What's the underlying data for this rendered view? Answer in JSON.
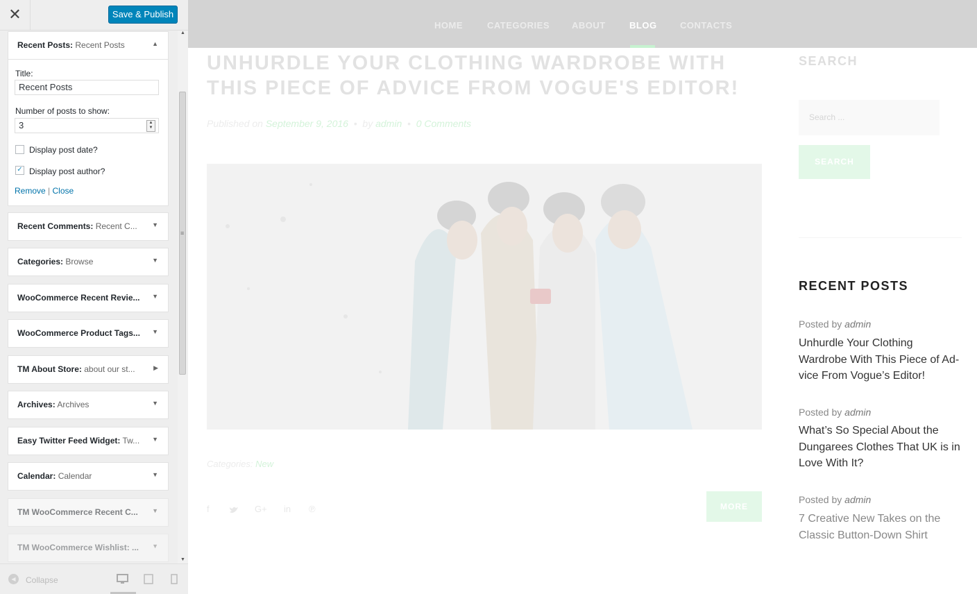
{
  "customizer": {
    "close_glyph": "✕",
    "publish_label": "Save & Publish",
    "open_widget": {
      "name_bold": "Recent Posts:",
      "name_sub": "Recent Posts",
      "arrow": "▲",
      "title_label": "Title:",
      "title_value": "Recent Posts",
      "count_label": "Number of posts to show:",
      "count_value": "3",
      "show_date_label": "Display post date?",
      "show_date_checked": false,
      "show_author_label": "Display post author?",
      "show_author_checked": true,
      "remove_label": "Remove",
      "separator": "|",
      "close_label": "Close"
    },
    "widgets": [
      {
        "bold": "Recent Comments:",
        "sub": "Recent C...",
        "arrow": "▼"
      },
      {
        "bold": "Categories:",
        "sub": "Browse",
        "arrow": "▼"
      },
      {
        "bold": "WooCommerce Recent Revie...",
        "sub": "",
        "arrow": "▼"
      },
      {
        "bold": "WooCommerce Product Tags...",
        "sub": "",
        "arrow": "▼"
      },
      {
        "bold": "TM About Store:",
        "sub": "about our st...",
        "arrow": "▶"
      },
      {
        "bold": "Archives:",
        "sub": "Archives",
        "arrow": "▼"
      },
      {
        "bold": "Easy Twitter Feed Widget:",
        "sub": "Tw...",
        "arrow": "▼"
      },
      {
        "bold": "Calendar:",
        "sub": "Calendar",
        "arrow": "▼"
      },
      {
        "bold": "TM WooCommerce Recent C...",
        "sub": "",
        "arrow": "▼"
      },
      {
        "bold": "TM WooCommerce Wishlist: ...",
        "sub": "",
        "arrow": "▼"
      }
    ],
    "collapse_label": "Collapse",
    "device_icons": [
      "desktop-icon",
      "tablet-icon",
      "mobile-icon"
    ]
  },
  "site": {
    "nav": [
      "HOME",
      "CATEGORIES",
      "ABOUT",
      "BLOG",
      "CONTACTS"
    ],
    "nav_active": "BLOG",
    "post": {
      "title": "UNHURDLE YOUR CLOTHING WARDROBE WITH THIS PIECE OF ADVICE FROM VOGUE'S EDITOR!",
      "published_prefix": "Published on",
      "date": "September 9, 2016",
      "by_prefix": "by",
      "author": "admin",
      "comments": "0 Comments",
      "categories_label": "Categories:",
      "category": "New",
      "more_label": "MORE",
      "share_icons": [
        "facebook-icon",
        "twitter-icon",
        "google-plus-icon",
        "linkedin-icon",
        "pinterest-icon"
      ]
    },
    "search": {
      "heading": "SEARCH",
      "placeholder": "Search ...",
      "button": "SEARCH"
    },
    "recent_posts": {
      "heading": "RECENT POSTS",
      "posted_by": "Posted by",
      "items": [
        {
          "author": "admin",
          "title": "Unhurdle Your Clothing Wardrobe With This Piece of Ad-vice From Vogue’s Editor!"
        },
        {
          "author": "admin",
          "title": "What’s So Special About the Dungarees Clothes That UK is in Love With It?"
        },
        {
          "author": "admin",
          "title": "7 Creative New Takes on the Classic Button-Down Shirt"
        }
      ]
    }
  },
  "colors": {
    "publish_blue": "#0085ba",
    "link_blue": "#0073aa",
    "accent_green": "#c6f2d0"
  }
}
